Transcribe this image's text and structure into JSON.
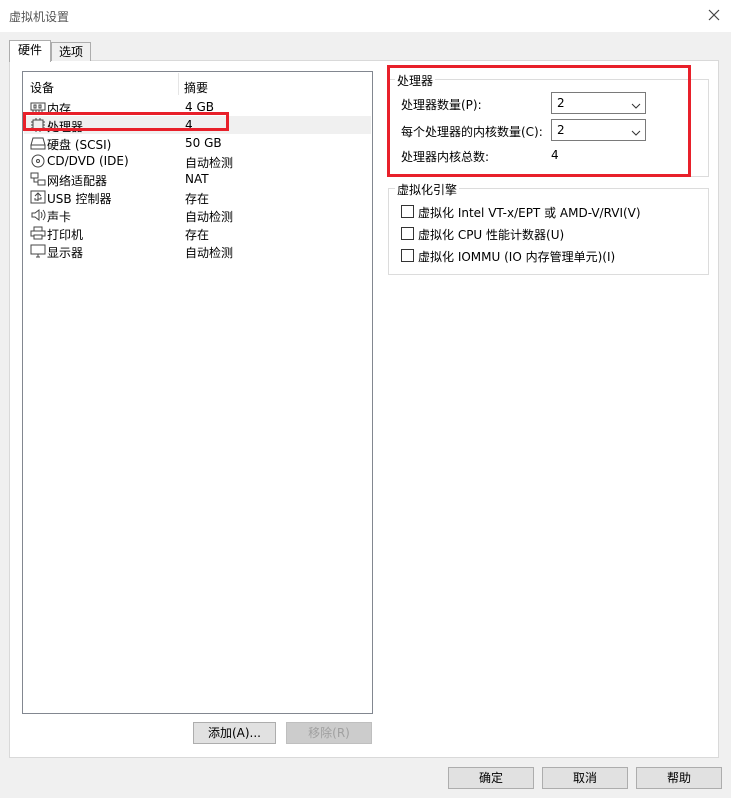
{
  "window": {
    "title": "虚拟机设置"
  },
  "tabs": [
    {
      "label": "硬件"
    },
    {
      "label": "选项"
    }
  ],
  "device_list": {
    "headers": {
      "device": "设备",
      "summary": "摘要"
    },
    "rows": [
      {
        "name": "内存",
        "summary": "4 GB",
        "icon": "memory-icon"
      },
      {
        "name": "处理器",
        "summary": "4",
        "icon": "processor-icon"
      },
      {
        "name": "硬盘 (SCSI)",
        "summary": "50 GB",
        "icon": "hard-disk-icon"
      },
      {
        "name": "CD/DVD (IDE)",
        "summary": "自动检测",
        "icon": "cd-dvd-icon"
      },
      {
        "name": "网络适配器",
        "summary": "NAT",
        "icon": "network-adapter-icon"
      },
      {
        "name": "USB 控制器",
        "summary": "存在",
        "icon": "usb-icon"
      },
      {
        "name": "声卡",
        "summary": "自动检测",
        "icon": "sound-card-icon"
      },
      {
        "name": "打印机",
        "summary": "存在",
        "icon": "printer-icon"
      },
      {
        "name": "显示器",
        "summary": "自动检测",
        "icon": "display-icon"
      }
    ],
    "selected_index": 1
  },
  "list_buttons": {
    "add": "添加(A)...",
    "remove": "移除(R)"
  },
  "processor_group": {
    "title": "处理器",
    "count_label": "处理器数量(P):",
    "count_value": "2",
    "cores_label": "每个处理器的内核数量(C):",
    "cores_value": "2",
    "total_label": "处理器内核总数:",
    "total_value": "4"
  },
  "virtualization_group": {
    "title": "虚拟化引擎",
    "options": [
      {
        "label": "虚拟化 Intel VT-x/EPT 或 AMD-V/RVI(V)",
        "checked": false
      },
      {
        "label": "虚拟化 CPU 性能计数器(U)",
        "checked": false
      },
      {
        "label": "虚拟化 IOMMU (IO 内存管理单元)(I)",
        "checked": false
      }
    ]
  },
  "footer_buttons": {
    "ok": "确定",
    "cancel": "取消",
    "help": "帮助"
  },
  "colors": {
    "highlight_box": "#e8202a",
    "window_bg": "#f0f0f0"
  }
}
